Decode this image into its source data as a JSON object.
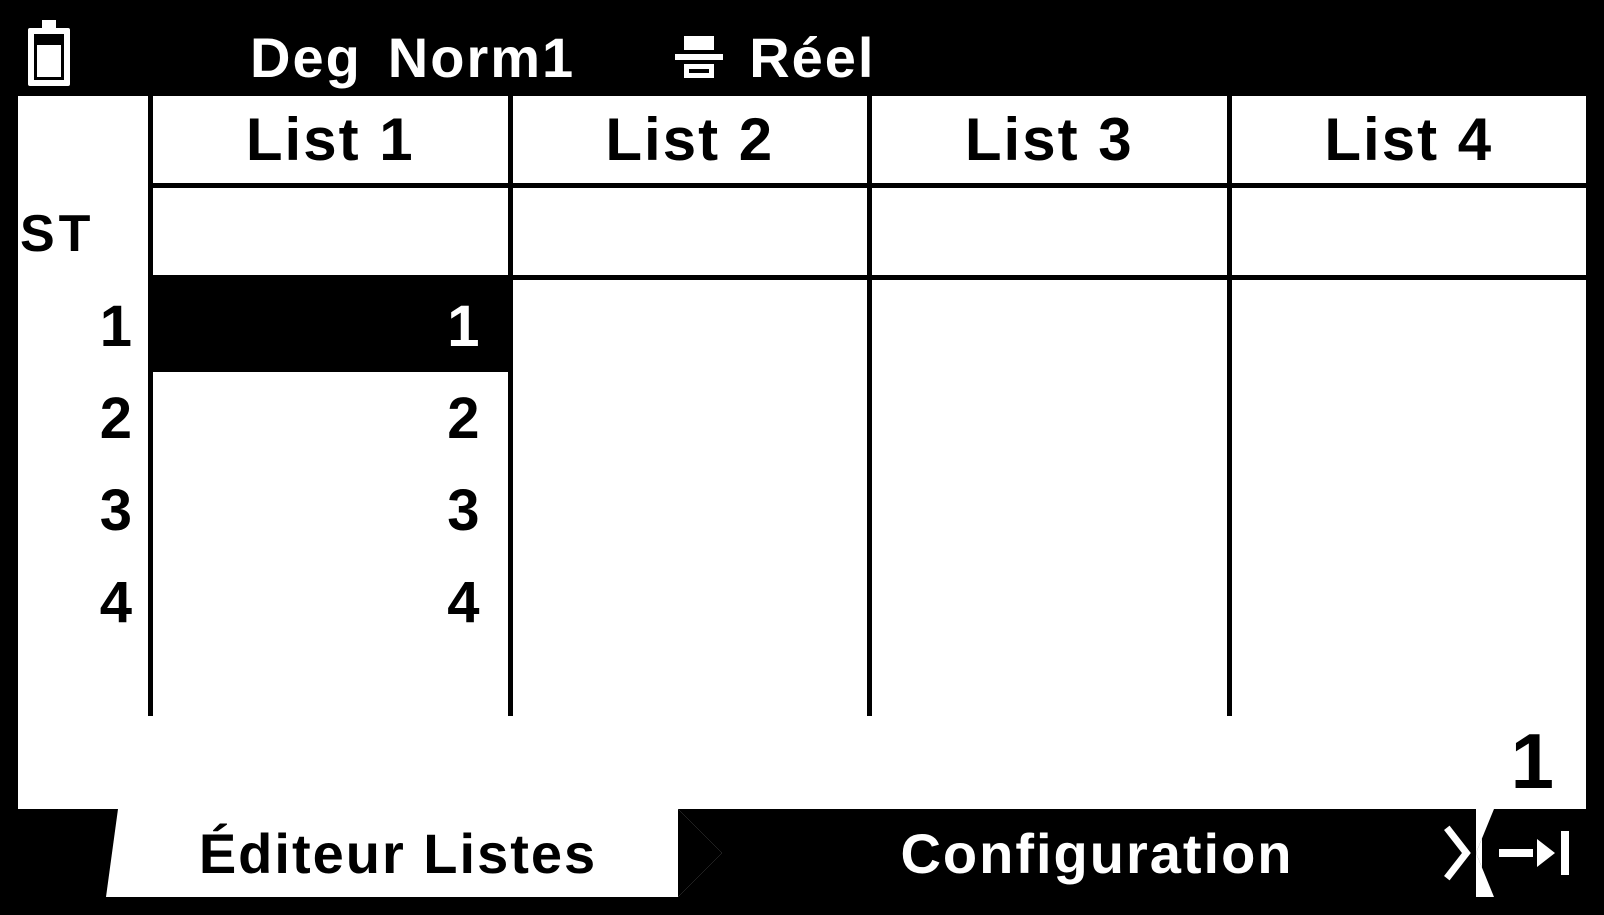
{
  "status": {
    "angle_mode": "Deg",
    "display_mode": "Norm1",
    "number_mode": "Réel"
  },
  "table": {
    "sub_label": "ST",
    "columns": [
      "List 1",
      "List 2",
      "List 3",
      "List 4"
    ],
    "row_indices": [
      "1",
      "2",
      "3",
      "4"
    ],
    "data": {
      "list1": [
        "1",
        "2",
        "3",
        "4"
      ],
      "list2": [
        "",
        "",
        "",
        ""
      ],
      "list3": [
        "",
        "",
        "",
        ""
      ],
      "list4": [
        "",
        "",
        "",
        ""
      ]
    },
    "selected": {
      "col": 0,
      "row": 0
    }
  },
  "echo_value": "1",
  "tabs": {
    "left": "Éditeur Listes",
    "right": "Configuration"
  }
}
